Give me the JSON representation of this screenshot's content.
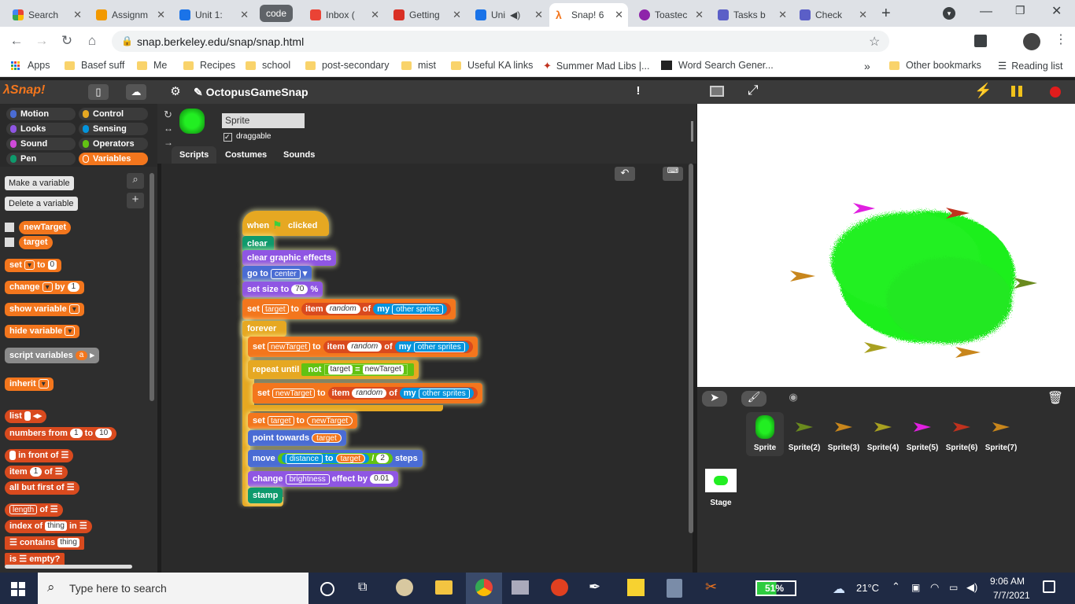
{
  "browser": {
    "tabs": [
      {
        "label": "Search",
        "color": "#4285f4"
      },
      {
        "label": "Assignm",
        "color": "#f29900"
      },
      {
        "label": "Unit 1:",
        "color": "#1a73e8"
      },
      {
        "label": "code",
        "color": "#5f6368"
      },
      {
        "label": "Inbox (",
        "color": "#ea4335"
      },
      {
        "label": "Getting",
        "color": "#d93025"
      },
      {
        "label": "Uni",
        "color": "#1a73e8"
      },
      {
        "label": "Snap! 6",
        "color": "#f3761d"
      },
      {
        "label": "Toastec",
        "color": "#8e24aa"
      },
      {
        "label": "Tasks b",
        "color": "#5b5fc7"
      },
      {
        "label": "Check",
        "color": "#5b5fc7"
      }
    ],
    "url": "snap.berkeley.edu/snap/snap.html",
    "bookmarks": [
      "Apps",
      "Basef suff",
      "Me",
      "Recipes",
      "school",
      "post-secondary",
      "mist",
      "Useful KA links",
      "Summer Mad Libs |...",
      "Word Search Gener..."
    ],
    "more_bookmarks": "»",
    "other_bookmarks": "Other bookmarks",
    "reading_list": "Reading list"
  },
  "snap": {
    "logo": "Snap!",
    "project_title": "OctopusGameSnap",
    "categories": [
      {
        "label": "Motion",
        "color": "#4a6cd4"
      },
      {
        "label": "Control",
        "color": "#e6a822"
      },
      {
        "label": "Looks",
        "color": "#8f56e3"
      },
      {
        "label": "Sensing",
        "color": "#0494dc"
      },
      {
        "label": "Sound",
        "color": "#cf4ad9"
      },
      {
        "label": "Operators",
        "color": "#62c213"
      },
      {
        "label": "Pen",
        "color": "#0e9a6c"
      },
      {
        "label": "Variables",
        "color": "#f3761d"
      }
    ],
    "palette": {
      "make_variable": "Make a variable",
      "delete_variable": "Delete a variable",
      "variables": [
        "newTarget",
        "target"
      ],
      "blocks": {
        "set": "set",
        "to": "to",
        "set_value": "0",
        "change": "change",
        "by": "by",
        "change_value": "1",
        "show_variable": "show variable",
        "hide_variable": "hide variable",
        "script_variables": "script variables",
        "script_var": "a",
        "inherit": "inherit",
        "list": "list",
        "numbers_from": "numbers from",
        "nf_a": "1",
        "nf_to": "to",
        "nf_b": "10",
        "in_front_of": "in front of",
        "item": "item",
        "item_val": "1",
        "of": "of",
        "all_but_first": "all but first of",
        "length": "length",
        "length_of": "of",
        "index_of": "index of",
        "thing": "thing",
        "in": "in",
        "contains": "contains",
        "contains_thing": "thing",
        "is_empty": "is",
        "empty": "empty?"
      }
    },
    "sprite": {
      "name": "Sprite",
      "draggable": "draggable"
    },
    "tabs": [
      "Scripts",
      "Costumes",
      "Sounds"
    ],
    "script": {
      "when": "when",
      "clicked": "clicked",
      "clear": "clear",
      "clear_graphic_effects": "clear graphic effects",
      "go_to": "go to",
      "center": "center",
      "set_size_to": "set size to",
      "size": "70",
      "pct": "%",
      "set": "set",
      "target": "target",
      "to": "to",
      "item": "item",
      "random": "random",
      "of": "of",
      "my": "my",
      "other_sprites": "other sprites",
      "forever": "forever",
      "newTarget": "newTarget",
      "repeat_until": "repeat until",
      "not": "not",
      "eq": "=",
      "point_towards": "point towards",
      "move": "move",
      "distance": "distance",
      "div": "/",
      "two": "2",
      "steps": "steps",
      "change": "change",
      "brightness": "brightness",
      "effect_by": "effect by",
      "effect_val": "0.01",
      "stamp": "stamp"
    },
    "corral": {
      "sprites": [
        "Sprite",
        "Sprite(2)",
        "Sprite(3)",
        "Sprite(4)",
        "Sprite(5)",
        "Sprite(6)",
        "Sprite(7)"
      ],
      "arrow_colors": [
        "#00e000",
        "#6a8a1e",
        "#c8861c",
        "#a8a020",
        "#e020e0",
        "#c0321e",
        "#c8861c"
      ],
      "stage": "Stage"
    }
  },
  "taskbar": {
    "search_placeholder": "Type here to search",
    "battery": "51%",
    "temperature": "21°C",
    "time": "9:06 AM",
    "date": "7/7/2021"
  }
}
